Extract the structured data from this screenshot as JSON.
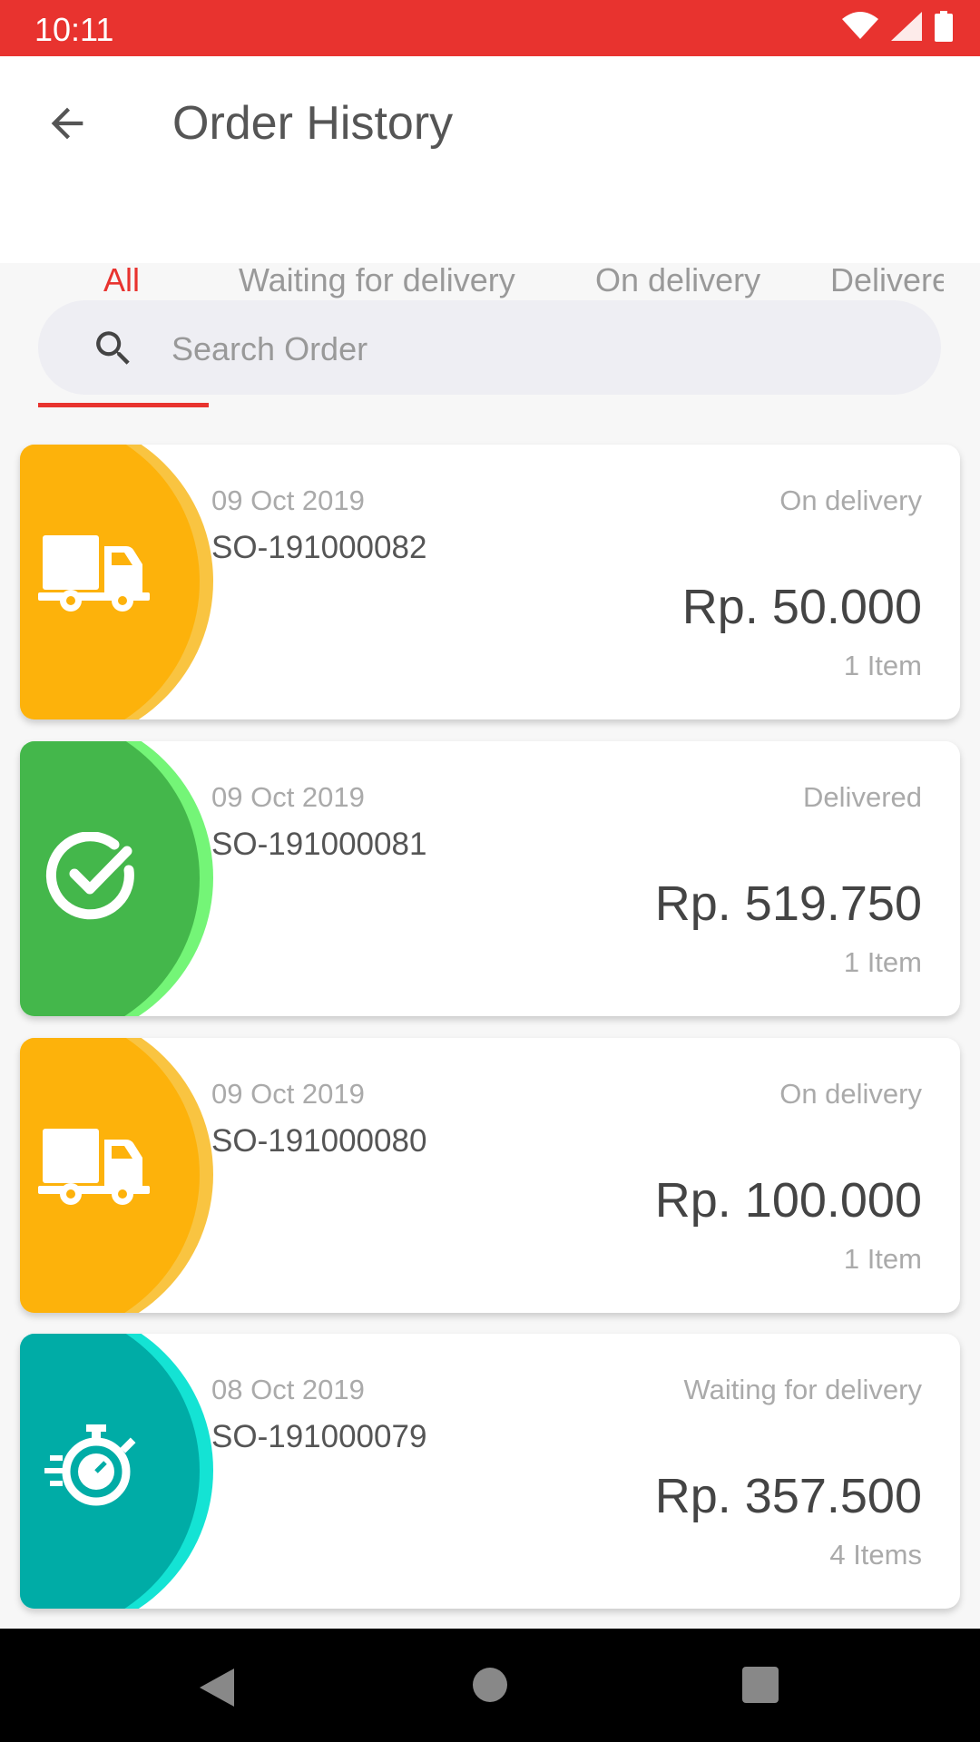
{
  "status_bar": {
    "time": "10:11"
  },
  "header": {
    "title": "Order History"
  },
  "tabs": [
    {
      "label": "All"
    },
    {
      "label": "Waiting for delivery"
    },
    {
      "label": "On delivery"
    },
    {
      "label": "Delivered"
    }
  ],
  "search": {
    "placeholder": "Search Order"
  },
  "orders": [
    {
      "date": "09 Oct 2019",
      "number": "SO-191000082",
      "status": "On delivery",
      "price": "Rp. 50.000",
      "items": "1 Item",
      "icon": "truck-icon",
      "color": "#FDB20B",
      "ring": "#F9C441"
    },
    {
      "date": "09 Oct 2019",
      "number": "SO-191000081",
      "status": "Delivered",
      "price": "Rp. 519.750",
      "items": "1 Item",
      "icon": "check-circle-icon",
      "color": "#44B74B",
      "ring": "#74F577"
    },
    {
      "date": "09 Oct 2019",
      "number": "SO-191000080",
      "status": "On delivery",
      "price": "Rp. 100.000",
      "items": "1 Item",
      "icon": "truck-icon",
      "color": "#FDB20B",
      "ring": "#F9C441"
    },
    {
      "date": "08 Oct 2019",
      "number": "SO-191000079",
      "status": "Waiting for delivery",
      "price": "Rp. 357.500",
      "items": "4 Items",
      "icon": "stopwatch-icon",
      "color": "#00ACA6",
      "ring": "#14E3D4"
    }
  ]
}
